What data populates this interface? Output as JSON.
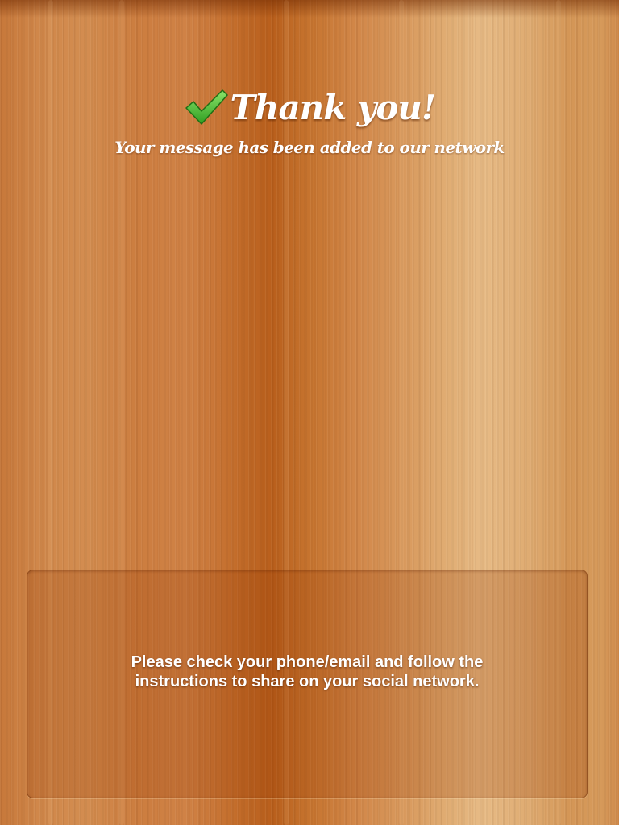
{
  "header": {
    "check_icon": "checkmark-icon",
    "check_color": "#3fb82e",
    "title": "Thank you!",
    "subtitle": "Your message has been added to our network"
  },
  "panel": {
    "instructions": "Please check your phone/email and follow the instructions to share on your social network."
  }
}
